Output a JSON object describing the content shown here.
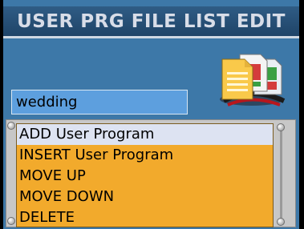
{
  "header": {
    "title": "USER PRG FILE LIST EDIT"
  },
  "file_name": {
    "value": "wedding"
  },
  "icon": {
    "name": "documents-icon"
  },
  "menu": {
    "items": [
      {
        "label": "ADD User Program",
        "selected": true
      },
      {
        "label": "INSERT User Program",
        "selected": false
      },
      {
        "label": "MOVE UP",
        "selected": false
      },
      {
        "label": "MOVE DOWN",
        "selected": false
      },
      {
        "label": "DELETE",
        "selected": false
      }
    ]
  },
  "colors": {
    "background": "#3d78a8",
    "title_bar": "#1f4468",
    "field": "#5d9fde",
    "menu": "#f2aa2c",
    "selected": "#dde3f2"
  }
}
